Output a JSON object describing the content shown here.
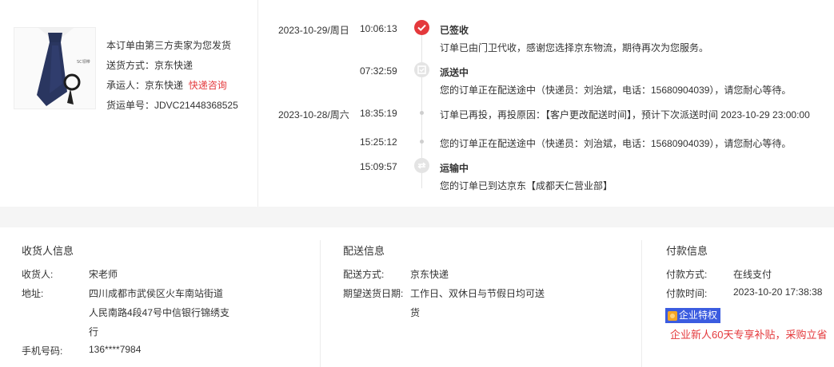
{
  "product": {
    "seller_note": "本订单由第三方卖家为您发货",
    "ship_method": "送货方式：京东快递",
    "carrier_label": "承运人：京东快递",
    "carrier_link": "快递咨询",
    "waybill": "货运单号：JDVC21448368525",
    "image_tag": "SC领带"
  },
  "timeline": {
    "events": [
      {
        "date": "2023-10-29/周日",
        "time": "10:06:13",
        "title": "已签收",
        "text": "订单已由门卫代收，感谢您选择京东物流，期待再次为您服务。",
        "icon": "check-icon"
      },
      {
        "date": "",
        "time": "07:32:59",
        "title": "派送中",
        "text": "您的订单正在配送途中（快递员：刘治斌，电话：15680904039），请您耐心等待。",
        "icon": "delivery-icon"
      },
      {
        "date": "2023-10-28/周六",
        "time": "18:35:19",
        "title": "",
        "text": "订单已再投，再投原因：【客户更改配送时间】，预计下次派送时间 2023-10-29 23:00:00",
        "icon": "dot"
      },
      {
        "date": "",
        "time": "15:25:12",
        "title": "",
        "text": "您的订单正在配送途中（快递员：刘治斌，电话：15680904039），请您耐心等待。",
        "icon": "dot"
      },
      {
        "date": "",
        "time": "15:09:57",
        "title": "运输中",
        "text": "您的订单已到达京东【成都天仁营业部】",
        "icon": "transport-icon"
      }
    ]
  },
  "receiver": {
    "title": "收货人信息",
    "name_label": "收货人:",
    "name": "宋老师",
    "address_label": "地址:",
    "address_lines": [
      "四川成都市武侯区火车南站街道",
      "人民南路4段47号中信银行锦绣支",
      "行"
    ],
    "phone_label": "手机号码:",
    "phone": "136****7984"
  },
  "delivery": {
    "title": "配送信息",
    "method_label": "配送方式:",
    "method": "京东快递",
    "date_label": "期望送货日期:",
    "date_lines": [
      "工作日、双休日与节假日均可送",
      "货"
    ]
  },
  "payment": {
    "title": "付款信息",
    "method_label": "付款方式:",
    "method": "在线支付",
    "time_label": "付款时间:",
    "time": "2023-10-20 17:38:38",
    "badge": "企业特权",
    "promo": "企业新人60天专享补贴，采购立省"
  },
  "colors": {
    "accent_red": "#e4393c",
    "badge_blue": "#3b5ce0",
    "band_grey": "#f5f5f5"
  }
}
